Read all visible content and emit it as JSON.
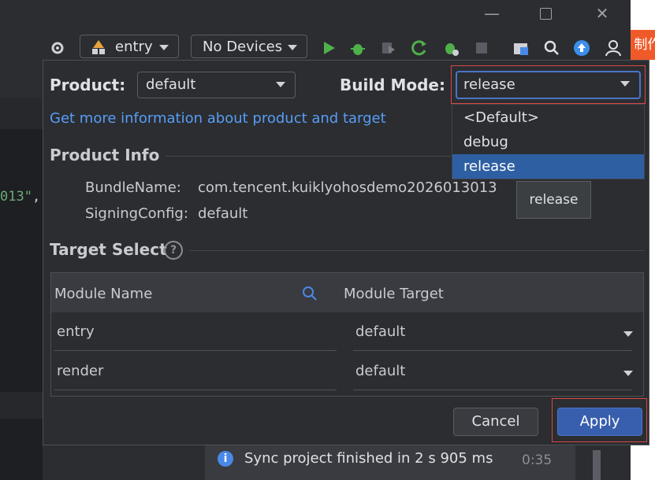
{
  "window": {
    "minimize_glyph": "—",
    "close_glyph": "✕"
  },
  "side_tag": "制作",
  "toolbar": {
    "module_label": "entry",
    "devices_label": "No Devices",
    "icons": [
      "gear-icon",
      "module-icon",
      "run-icon",
      "debug-icon",
      "attach-icon",
      "refresh-icon",
      "bug-run-icon",
      "stop-icon",
      "project-structure-icon",
      "search-icon",
      "update-icon",
      "profile-icon"
    ]
  },
  "background": {
    "code_fragment": "013\"",
    "code_comma": ","
  },
  "dialog": {
    "product_label": "Product:",
    "product_value": "default",
    "build_mode_label": "Build Mode:",
    "build_mode_value": "release",
    "info_link": "Get more information about product and target",
    "product_info_title": "Product Info",
    "bundle_name_label": "BundleName:",
    "bundle_name_value": "com.tencent.kuiklyohosdemo2026013013",
    "signing_config_label": "SigningConfig:",
    "signing_config_value": "default",
    "tooltip": "release",
    "target_select_title": "Target Select",
    "help_glyph": "?",
    "table": {
      "headers": {
        "module_name": "Module Name",
        "module_target": "Module Target"
      },
      "rows": [
        {
          "module": "entry",
          "target": "default"
        },
        {
          "module": "render",
          "target": "default"
        }
      ]
    },
    "build_mode_options": [
      "<Default>",
      "debug",
      "release"
    ],
    "cancel_label": "Cancel",
    "apply_label": "Apply"
  },
  "notification": {
    "icon_glyph": "i",
    "text": "Sync project finished in 2 s 905 ms",
    "time": "0:35"
  },
  "colors": {
    "accent": "#375fad",
    "link": "#589df6",
    "highlight": "#d94848",
    "selection": "#2e5fa3",
    "orange": "#f05a28"
  }
}
